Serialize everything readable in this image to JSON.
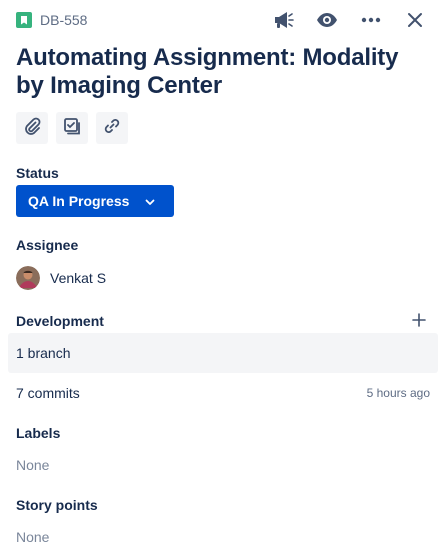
{
  "issue": {
    "key": "DB-558",
    "title": "Automating Assignment: Modality by Imaging Center"
  },
  "header_actions": {
    "icons": [
      "megaphone-icon",
      "eye-icon",
      "more-icon",
      "close-icon"
    ]
  },
  "quick_actions": {
    "icons": [
      "paperclip-icon",
      "subtask-icon",
      "link-icon"
    ]
  },
  "status": {
    "label": "Status",
    "value": "QA In Progress"
  },
  "assignee": {
    "label": "Assignee",
    "name": "Venkat S"
  },
  "development": {
    "label": "Development",
    "branch_text": "1 branch",
    "commits_text": "7 commits",
    "commits_time": "5 hours ago"
  },
  "labels": {
    "label": "Labels",
    "value": "None"
  },
  "story_points": {
    "label": "Story points",
    "value": "None"
  },
  "colors": {
    "status_bg": "#0052cc",
    "story_icon": "#36b37e",
    "text": "#172b4d",
    "muted": "#7a869a"
  }
}
